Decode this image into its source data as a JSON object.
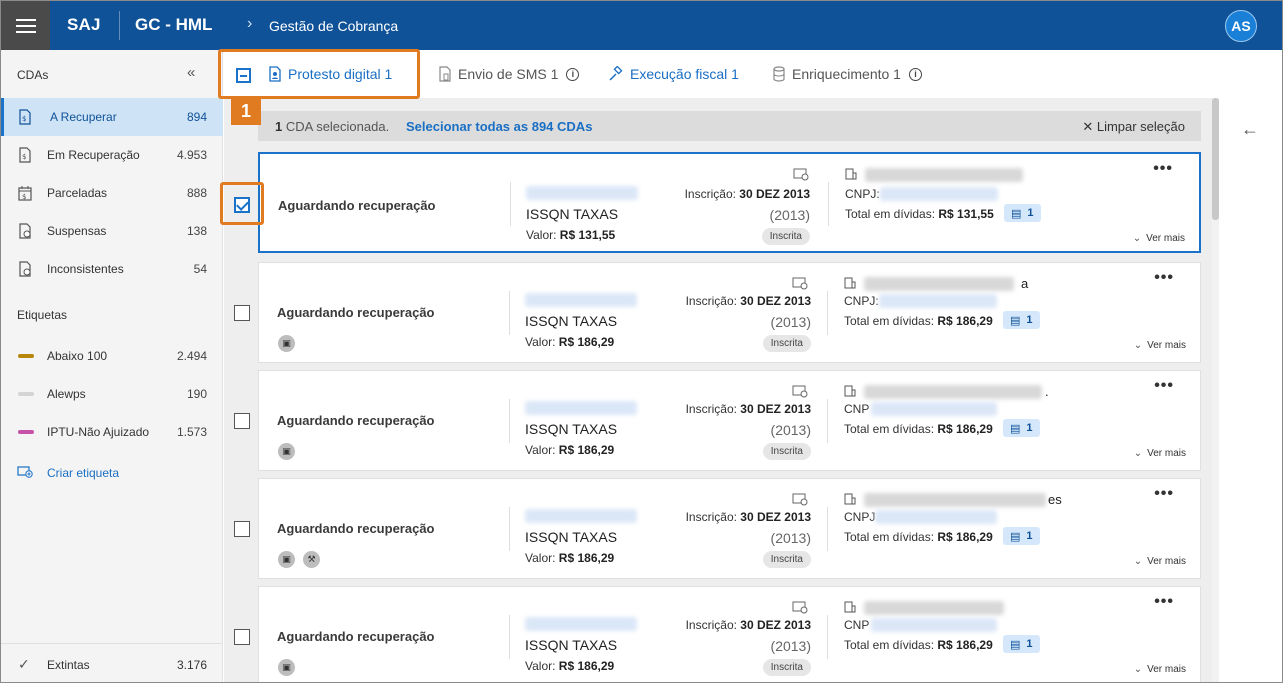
{
  "header": {
    "brand": "SAJ",
    "app_name": "GC - HML",
    "breadcrumb": "Gestão de Cobrança",
    "avatar_initials": "AS",
    "bar_color": "#0f5298"
  },
  "sidebar": {
    "title": "CDAs",
    "collapse_glyph": "«",
    "items": [
      {
        "label": "A Recuperar",
        "count": "894",
        "icon": "document-dollar-icon"
      },
      {
        "label": "Em Recuperação",
        "count": "4.953",
        "icon": "document-dollar-icon"
      },
      {
        "label": "Parceladas",
        "count": "888",
        "icon": "calendar-dollar-icon"
      },
      {
        "label": "Suspensas",
        "count": "138",
        "icon": "document-pause-icon"
      },
      {
        "label": "Inconsistentes",
        "count": "54",
        "icon": "document-alert-icon"
      }
    ],
    "tags_title": "Etiquetas",
    "tags": [
      {
        "label": "Abaixo 100",
        "count": "2.494",
        "color": "#b8860b"
      },
      {
        "label": "Alewps",
        "count": "190",
        "color": "#d4d4d4"
      },
      {
        "label": "IPTU-Não Ajuizado",
        "count": "1.573",
        "color": "#c552a8"
      }
    ],
    "create_tag": "Criar etiqueta",
    "bottom": {
      "label": "Extintas",
      "count": "3.176"
    }
  },
  "toolbar": {
    "actions": [
      {
        "label": "Protesto digital 1"
      },
      {
        "label": "Envio de SMS 1"
      },
      {
        "label": "Execução fiscal 1"
      },
      {
        "label": "Enriquecimento 1"
      }
    ],
    "info_glyph": "i",
    "step_label": "1"
  },
  "selection_bar": {
    "count": "1",
    "text": " CDA selecionada.",
    "select_all": "Selecionar todas as 894 CDAs",
    "clear": "✕ Limpar seleção"
  },
  "cards": [
    {
      "status": "Aguardando recuperação",
      "tipo": "ISSQN TAXAS",
      "valor_label": "Valor: ",
      "valor": "R$ 131,55",
      "insc_label": "Inscrição: ",
      "insc_date": "30 DEZ 2013",
      "ano": "(2013)",
      "pill": "Inscrita",
      "cnpj_label": "CNPJ:",
      "total_label": "Total em dívidas: ",
      "total": "R$ 131,55",
      "docs": "1",
      "suffix": "",
      "ver_mais": "Ver mais"
    },
    {
      "status": "Aguardando recuperação",
      "tipo": "ISSQN TAXAS",
      "valor_label": "Valor: ",
      "valor": "R$ 186,29",
      "insc_label": "Inscrição: ",
      "insc_date": "30 DEZ 2013",
      "ano": "(2013)",
      "pill": "Inscrita",
      "cnpj_label": "CNPJ:",
      "total_label": "Total em dívidas: ",
      "total": "R$ 186,29",
      "docs": "1",
      "suffix": "a",
      "ver_mais": "Ver mais"
    },
    {
      "status": "Aguardando recuperação",
      "tipo": "ISSQN TAXAS",
      "valor_label": "Valor: ",
      "valor": "R$ 186,29",
      "insc_label": "Inscrição: ",
      "insc_date": "30 DEZ 2013",
      "ano": "(2013)",
      "pill": "Inscrita",
      "cnpj_label": "CNP",
      "total_label": "Total em dívidas: ",
      "total": "R$ 186,29",
      "docs": "1",
      "suffix": ".",
      "ver_mais": "Ver mais"
    },
    {
      "status": "Aguardando recuperação",
      "tipo": "ISSQN TAXAS",
      "valor_label": "Valor: ",
      "valor": "R$ 186,29",
      "insc_label": "Inscrição: ",
      "insc_date": "30 DEZ 2013",
      "ano": "(2013)",
      "pill": "Inscrita",
      "cnpj_label": "CNPJ",
      "total_label": "Total em dívidas: ",
      "total": "R$ 186,29",
      "docs": "1",
      "suffix": "es",
      "ver_mais": "Ver mais"
    },
    {
      "status": "Aguardando recuperação",
      "tipo": "ISSQN TAXAS",
      "valor_label": "Valor: ",
      "valor": "R$ 186,29",
      "insc_label": "Inscrição: ",
      "insc_date": "30 DEZ 2013",
      "ano": "(2013)",
      "pill": "Inscrita",
      "cnpj_label": "CNP",
      "total_label": "Total em dívidas: ",
      "total": "R$ 186,29",
      "docs": "1",
      "suffix": "",
      "ver_mais": "Ver mais"
    }
  ],
  "accent_color": "#1a73c9",
  "highlight_color": "#e07b22"
}
